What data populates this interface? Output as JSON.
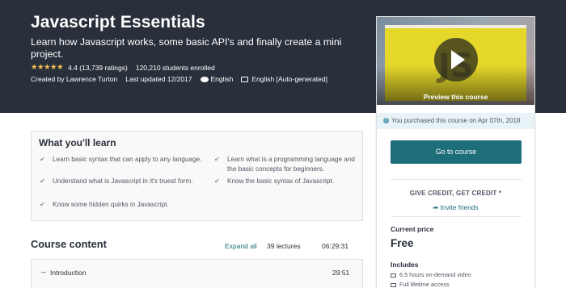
{
  "course": {
    "title": "Javascript Essentials",
    "subtitle": "Learn how Javascript works, some basic API's and finally create a mini project.",
    "stars": "★★★★★",
    "rating": "4.4",
    "ratings_count": "(13,739 ratings)",
    "students": "120,210 students enrolled",
    "created_by": "Created by Lawrence Turton",
    "last_updated": "Last updated 12/2017",
    "language": "English",
    "captions": "English [Auto-generated]"
  },
  "sidebar_card": {
    "preview_label": "Preview this course",
    "preview_logo": "JS",
    "purchased_notice": "You purchased this course on Apr 07th, 2018",
    "go_button": "Go to course",
    "give_credit": "GIVE CREDIT, GET CREDIT *",
    "invite_friends": "Invite friends",
    "current_price_label": "Current price",
    "price": "Free",
    "includes_label": "Includes",
    "includes": [
      "6.5 hours on-demand video",
      "Full lifetime access"
    ]
  },
  "learn": {
    "title": "What you'll learn",
    "left_items": [
      "Learn basic syntax that can apply to any language.",
      "Understand what is Javascript in it's truest form.",
      "Know some hidden quirks in Javascript."
    ],
    "right_items": [
      "Learn what is a programming language and the basic concepts for beginners.",
      "Know the basic syntax of Javascript."
    ]
  },
  "course_content": {
    "title": "Course content",
    "expand_all": "Expand all",
    "lectures": "39 lectures",
    "duration": "06:29:31",
    "sections": [
      {
        "title": "Introduction",
        "time": "29:51"
      }
    ]
  },
  "colors": {
    "hero_bg": "#29303b",
    "accent": "#1e6d7a",
    "star": "#f4c150",
    "notice_bg": "#e8f3f7"
  },
  "icons": [
    "star-icon",
    "speech-bubble-icon",
    "closed-caption-icon",
    "play-icon",
    "info-icon",
    "checkmark-icon",
    "invite-icon",
    "video-icon",
    "lifetime-icon",
    "minus-icon"
  ]
}
